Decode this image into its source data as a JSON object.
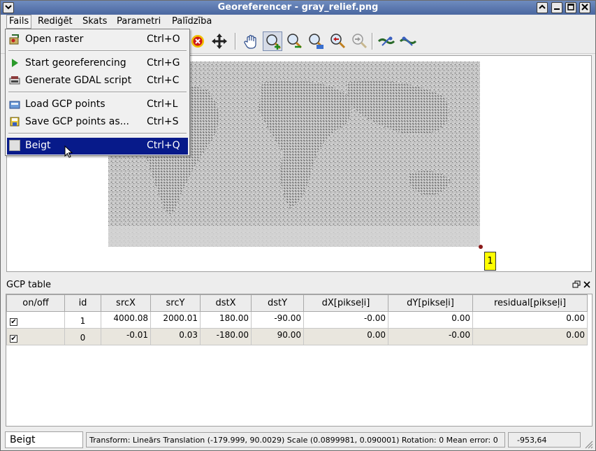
{
  "window": {
    "title": "Georeferencer - gray_relief.png"
  },
  "menubar": {
    "items": [
      "Fails",
      "Rediģēt",
      "Skats",
      "Parametri",
      "Palīdzība"
    ]
  },
  "file_menu": {
    "items": [
      {
        "label": "Open raster",
        "shortcut": "Ctrl+O",
        "icon": "open-raster-icon"
      },
      {
        "label": "Start georeferencing",
        "shortcut": "Ctrl+G",
        "icon": "play-icon"
      },
      {
        "label": "Generate GDAL script",
        "shortcut": "Ctrl+C",
        "icon": "gdal-script-icon"
      },
      {
        "label": "Load GCP points",
        "shortcut": "Ctrl+L",
        "icon": "load-gcp-icon"
      },
      {
        "label": "Save GCP points as...",
        "shortcut": "Ctrl+S",
        "icon": "save-gcp-icon"
      },
      {
        "label": "Beigt",
        "shortcut": "Ctrl+Q",
        "icon": "quit-icon",
        "selected": true
      }
    ]
  },
  "toolbar": {
    "icons": [
      "delete-point-icon",
      "move-point-icon",
      "pan-icon",
      "zoom-in-icon",
      "zoom-out-icon",
      "zoom-layer-icon",
      "zoom-last-icon",
      "zoom-next-icon",
      "link-georef-icon",
      "link-qgis-icon"
    ]
  },
  "canvas": {
    "gcp_label": "1"
  },
  "gcp_table": {
    "title": "GCP table",
    "columns": [
      "on/off",
      "id",
      "srcX",
      "srcY",
      "dstX",
      "dstY",
      "dX[pikseļi]",
      "dY[pikseļi]",
      "residual[pikseļi]"
    ],
    "rows": [
      {
        "checked": true,
        "id": "1",
        "srcX": "4000.08",
        "srcY": "2000.01",
        "dstX": "180.00",
        "dstY": "-90.00",
        "dX": "-0.00",
        "dY": "0.00",
        "residual": "0.00"
      },
      {
        "checked": true,
        "id": "0",
        "srcX": "-0.01",
        "srcY": "0.03",
        "dstX": "-180.00",
        "dstY": "90.00",
        "dX": "0.00",
        "dY": "-0.00",
        "residual": "0.00"
      }
    ]
  },
  "statusbar": {
    "message": "Beigt",
    "transform": "Transform: Lineārs Translation (-179.999, 90.0029) Scale (0.0899981, 0.090001) Rotation: 0 Mean error: 0",
    "coords": "-953,64"
  },
  "colors": {
    "title_bar": "#5a77ad",
    "menu_highlight": "#071a8a",
    "gcp_label_bg": "#ffff00",
    "row_alt": "#e9e6de"
  }
}
